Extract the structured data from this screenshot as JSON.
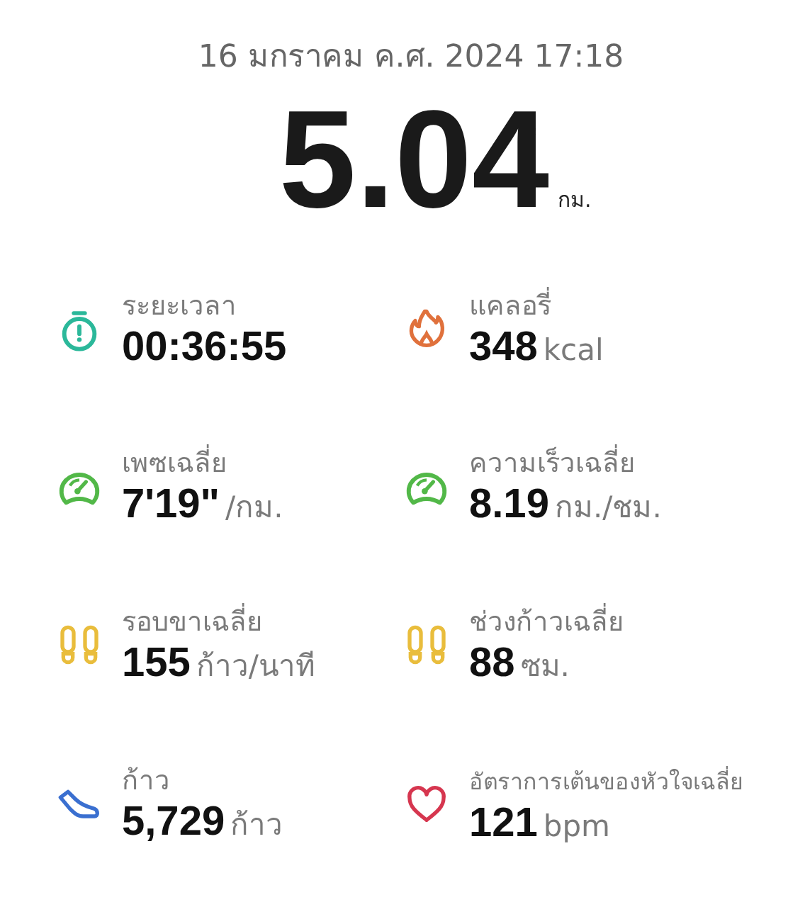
{
  "date": "16 มกราคม ค.ศ. 2024 17:18",
  "distance": {
    "value": "5.04",
    "unit": "กม."
  },
  "stats": [
    {
      "kind": "stopwatch",
      "color": "#2bb89a",
      "label": "ระยะเวลา",
      "value": "00:36:55"
    },
    {
      "kind": "flame",
      "color": "#e0713c",
      "label": "แคลอรี่",
      "value": "348",
      "unit": "kcal"
    },
    {
      "kind": "gauge",
      "color": "#52b848",
      "label": "เพซเฉลี่ย",
      "value": "7'19\"",
      "unit": "/กม."
    },
    {
      "kind": "gauge",
      "color": "#52b848",
      "label": "ความเร็วเฉลี่ย",
      "value": "8.19",
      "unit": "กม./ชม."
    },
    {
      "kind": "footprints",
      "color": "#e9bd3c",
      "label": "รอบขาเฉลี่ย",
      "value": "155",
      "unit": "ก้าว/นาที"
    },
    {
      "kind": "footprints",
      "color": "#e9bd3c",
      "label": "ช่วงก้าวเฉลี่ย",
      "value": "88",
      "unit": "ซม."
    },
    {
      "kind": "shoe",
      "color": "#3a6fd0",
      "label": "ก้าว",
      "value": "5,729",
      "unit": "ก้าว"
    },
    {
      "kind": "heart",
      "color": "#d6364f",
      "label": "อัตราการเต้นของหัวใจเฉลี่ย",
      "value": "121",
      "unit": "bpm"
    }
  ]
}
